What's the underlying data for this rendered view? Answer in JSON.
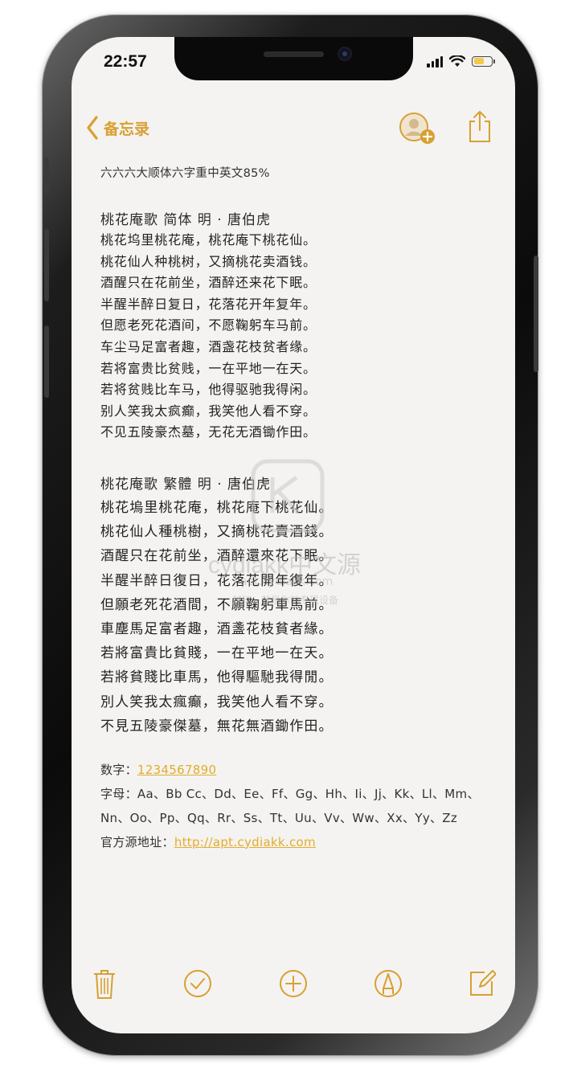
{
  "status": {
    "time": "22:57"
  },
  "nav": {
    "back_label": "备忘录"
  },
  "note": {
    "header": "六六六大顺体六字重中英文85%",
    "simplified": {
      "title": "桃花庵歌  简体   明 · 唐伯虎",
      "lines": [
        "桃花坞里桃花庵，桃花庵下桃花仙。",
        "桃花仙人种桃树，又摘桃花卖酒钱。",
        "酒醒只在花前坐，酒醉还来花下眠。",
        "半醒半醉日复日，花落花开年复年。",
        "但愿老死花酒间，不愿鞠躬车马前。",
        "车尘马足富者趣，酒盏花枝贫者缘。",
        "若将富贵比贫贱，一在平地一在天。",
        "若将贫贱比车马，他得驱驰我得闲。",
        "别人笑我太疯癫，我笑他人看不穿。",
        "不见五陵豪杰墓，无花无酒锄作田。"
      ]
    },
    "traditional": {
      "title": "桃花庵歌  繁體      明 · 唐伯虎",
      "lines": [
        "桃花塢里桃花庵，桃花庵下桃花仙。",
        "桃花仙人種桃樹，又摘桃花賣酒錢。",
        "酒醒只在花前坐，酒醉還來花下眠。",
        "半醒半醉日復日，花落花開年復年。",
        "但願老死花酒間，不願鞠躬車馬前。",
        "車塵馬足富者趣，酒盞花枝貧者緣。",
        "若將富貴比貧賤，一在平地一在天。",
        "若將貧賤比車馬，他得驅馳我得閒。",
        "別人笑我太瘋癲，我笑他人看不穿。",
        "不見五陵豪傑墓，無花無酒鋤作田。"
      ]
    },
    "digits_label": "数字：",
    "digits_value": "1234567890",
    "letters_label": "字母：",
    "letters_line1": "Aa、Bb Cc、Dd、Ee、Ff、Gg、Hh、Ii、Jj、Kk、Ll、Mm、",
    "letters_line2": "Nn、Oo、Pp、Qq、Rr、Ss、Tt、Uu、Vv、Ww、Xx、Yy、Zz",
    "source_label": "官方源地址：",
    "source_url": "http://apt.cydiakk.com"
  },
  "watermark": {
    "brand": "cydiakk中文源",
    "url": "apt.cydiakk.com",
    "tagline": "越狱，就是你的专属设备"
  },
  "colors": {
    "accent": "#d8a032",
    "link": "#e3ac2c",
    "paper": "#f4f3f1"
  },
  "icons": [
    "chevron-left-icon",
    "add-person-icon",
    "share-icon",
    "trash-icon",
    "checkmark-circle-icon",
    "plus-circle-icon",
    "pen-markup-icon",
    "compose-icon"
  ]
}
